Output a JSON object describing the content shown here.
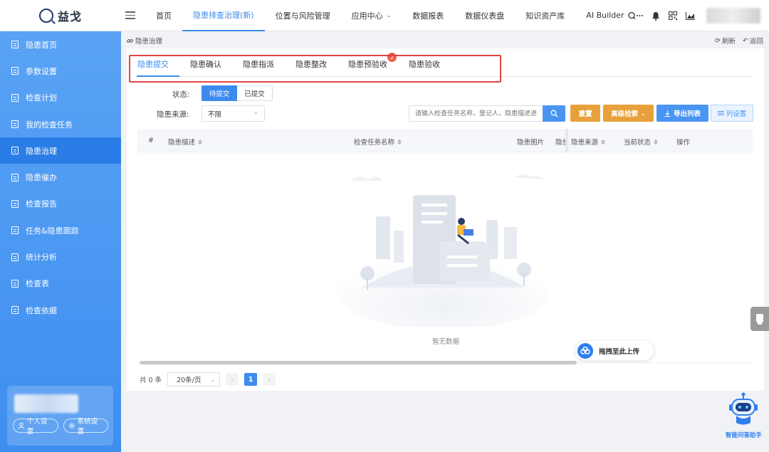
{
  "app": {
    "logo_text": "益戈"
  },
  "nav": {
    "items": [
      {
        "label": "首页"
      },
      {
        "label": "隐患排查治理(新)"
      },
      {
        "label": "位置与风险管理"
      },
      {
        "label": "应用中心"
      },
      {
        "label": "数据报表"
      },
      {
        "label": "数据仪表盘"
      },
      {
        "label": "知识资产库"
      },
      {
        "label": "AI Builder"
      }
    ],
    "active_index": 1,
    "dropdown_caret": "⌄"
  },
  "sidebar": {
    "items": [
      {
        "label": "隐患首页"
      },
      {
        "label": "参数设置"
      },
      {
        "label": "检查计划"
      },
      {
        "label": "我的检查任务"
      },
      {
        "label": "隐患治理"
      },
      {
        "label": "隐患催办"
      },
      {
        "label": "检查报告"
      },
      {
        "label": "任务&隐患跟踪"
      },
      {
        "label": "统计分析"
      },
      {
        "label": "检查表"
      },
      {
        "label": "检查依据"
      }
    ],
    "active_index": 4,
    "user_buttons": {
      "profile": "个人设置",
      "system": "系统设置"
    }
  },
  "breadcrumb": {
    "current": "隐患治理"
  },
  "top_actions": {
    "refresh": "刷新",
    "back": "返回"
  },
  "tabs": [
    {
      "label": "隐患提交"
    },
    {
      "label": "隐患确认"
    },
    {
      "label": "隐患指派"
    },
    {
      "label": "隐患整改"
    },
    {
      "label": "隐患预验收",
      "badge": "2"
    },
    {
      "label": "隐患验收"
    }
  ],
  "filters": {
    "status_label": "状态:",
    "status_options": [
      "待提交",
      "已提交"
    ],
    "status_selected": "待提交",
    "source_label": "隐患来源:",
    "source_value": "不限",
    "search_placeholder": "请输入检查任务名称，登记人，隐患描述进"
  },
  "buttons": {
    "reset": "重置",
    "advanced": "高级检索",
    "export": "导出列表",
    "columns": "列设置"
  },
  "table": {
    "headers": [
      "#",
      "隐患描述",
      "检查任务名称",
      "隐患图片",
      "隐患",
      "隐患来源",
      "当前状态",
      "操作"
    ],
    "rows": [],
    "empty_text": "暂无数据"
  },
  "upload": {
    "label": "拖拽至此上传"
  },
  "pagination": {
    "total": "共 0 条",
    "page_size": "20条/页",
    "current_page": "1",
    "prev": "‹",
    "next": "›"
  },
  "assistant": {
    "label": "智能问答助手"
  },
  "colors": {
    "primary": "#3d8bef",
    "warning": "#e8a13a",
    "highlight": "#e04545",
    "badge": "#f05a4a"
  }
}
